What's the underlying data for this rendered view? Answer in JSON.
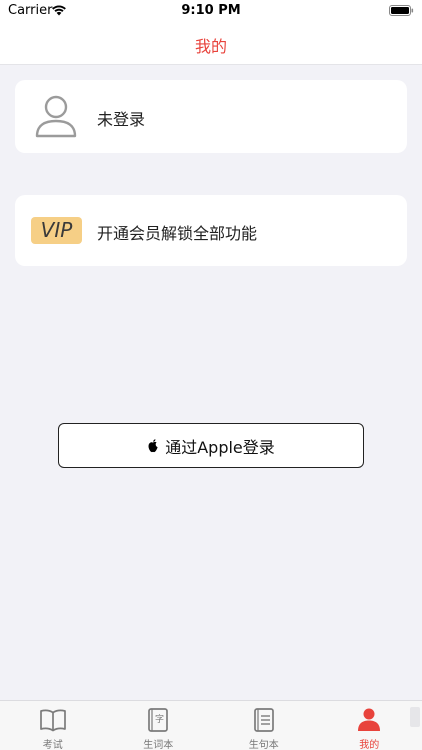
{
  "status_bar": {
    "carrier": "Carrier",
    "time": "9:10 PM"
  },
  "nav": {
    "title": "我的"
  },
  "login_card": {
    "label": "未登录"
  },
  "vip_card": {
    "badge": "VIP",
    "label": "开通会员解锁全部功能"
  },
  "apple_signin": {
    "label": "通过Apple登录"
  },
  "tabs": [
    {
      "label": "考试",
      "icon": "book-icon",
      "active": false
    },
    {
      "label": "生词本",
      "icon": "vocabulary-icon",
      "active": false
    },
    {
      "label": "生句本",
      "icon": "notebook-icon",
      "active": false
    },
    {
      "label": "我的",
      "icon": "person-icon",
      "active": true
    }
  ],
  "colors": {
    "accent": "#e8433c",
    "vip_badge": "#f6cf86",
    "background": "#f2f2f7"
  }
}
